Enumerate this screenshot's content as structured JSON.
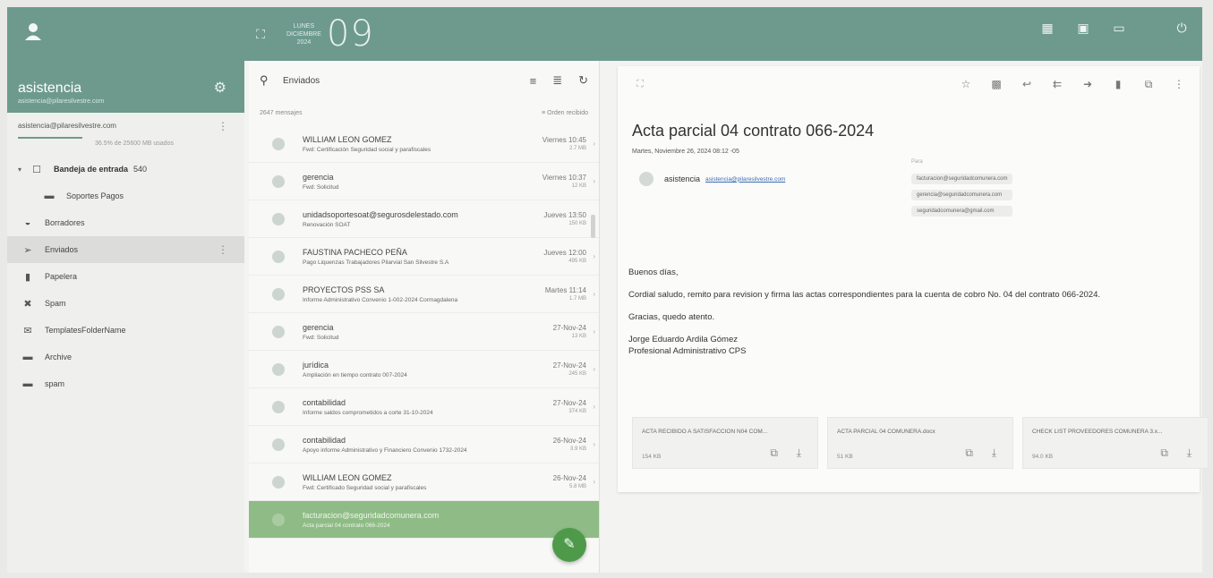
{
  "topbar": {
    "weekday": "LUNES",
    "month": "DICIEMBRE",
    "year": "2024",
    "day": "09"
  },
  "account": {
    "name": "asistencia",
    "email": "asistencia@pilaresilvestre.com",
    "account_line": "asistencia@pilaresilvestre.com",
    "quota": "36.5% de 25600 MB usados"
  },
  "folders": [
    {
      "label": "Bandeja de entrada",
      "count": "540"
    },
    {
      "label": "Soportes Pagos"
    },
    {
      "label": "Borradores"
    },
    {
      "label": "Enviados"
    },
    {
      "label": "Papelera"
    },
    {
      "label": "Spam"
    },
    {
      "label": "TemplatesFolderName"
    },
    {
      "label": "Archive"
    },
    {
      "label": "spam"
    }
  ],
  "list": {
    "title": "Enviados",
    "count": "2647 mensajes",
    "sort": "Orden recibido",
    "messages": [
      {
        "from": "WILLIAM LEON GOMEZ",
        "subject": "Fwd: Certificación Seguridad social y parafiscales",
        "date": "Viernes 10:45",
        "size": "2.7 MB"
      },
      {
        "from": "gerencia",
        "subject": "Fwd: Solicitud",
        "date": "Viernes 10:37",
        "size": "12 KB"
      },
      {
        "from": "unidadsoportesoat@segurosdelestado.com",
        "subject": "Renovación SOAT",
        "date": "Jueves 13:50",
        "size": "150 KB"
      },
      {
        "from": "FAUSTINA PACHECO PEÑA",
        "subject": "Pago Liquenzas Trabajadores Pilarvial San Silvestre S.A",
        "date": "Jueves 12:00",
        "size": "495 KB"
      },
      {
        "from": "PROYECTOS PSS SA",
        "subject": "Informe Administrativo Convenio 1-002-2024 Cormagdalena",
        "date": "Martes 11:14",
        "size": "1.7 MB"
      },
      {
        "from": "gerencia",
        "subject": "Fwd: Solicitud",
        "date": "27-Nov-24",
        "size": "13 KB"
      },
      {
        "from": "jurídica",
        "subject": "Ampliación en tiempo contrato 007-2024",
        "date": "27-Nov-24",
        "size": "245 KB"
      },
      {
        "from": "contabilidad",
        "subject": "Informe saldos comprometidos a corte 31-10-2024",
        "date": "27-Nov-24",
        "size": "374 KB"
      },
      {
        "from": "contabilidad",
        "subject": "Apoyo informe Administrativo y Financiero Convenio 1732-2024",
        "date": "26-Nov-24",
        "size": "3.9 KB"
      },
      {
        "from": "WILLIAM LEON GOMEZ",
        "subject": "Fwd: Certificado Seguridad social y parafiscales",
        "date": "26-Nov-24",
        "size": "5.8 MB"
      },
      {
        "from": "facturacion@seguridadcomunera.com",
        "subject": "Acta parcial 04 contrato 066-2024",
        "date": "",
        "size": ""
      }
    ]
  },
  "reader": {
    "subject": "Acta parcial 04 contrato 066-2024",
    "date": "Martes, Noviembre 26, 2024 08:12 -05",
    "sender_name": "asistencia",
    "sender_email": "asistencia@pilaresilvestre.com",
    "para_label": "Para",
    "recipients": [
      "facturacion@seguridadcomunera.com",
      "gerencia@seguridadcomunera.com",
      "seguridadcomunera@gmail.com"
    ],
    "body": [
      "Buenos días,",
      "Cordial saludo, remito para revision y firma las actas correspondientes para la cuenta de cobro No. 04 del contrato 066-2024.",
      "Gracias, quedo atento.",
      "Jorge Eduardo Ardila Gómez",
      "Profesional Administrativo CPS"
    ],
    "attachments": [
      {
        "name": "ACTA RECIBIDO A SATISFACCION N04 COM...",
        "size": "154 KB"
      },
      {
        "name": "ACTA PARCIAL 04 COMUNERA.docx",
        "size": "51 KB"
      },
      {
        "name": "CHECK LIST PROVEEDORES COMUNERA 3.x...",
        "size": "94.0 KB"
      }
    ]
  },
  "colors": {
    "accent": "#6e9a8e",
    "selected_row": "#8fbc86",
    "fab": "#4f9a4a"
  }
}
